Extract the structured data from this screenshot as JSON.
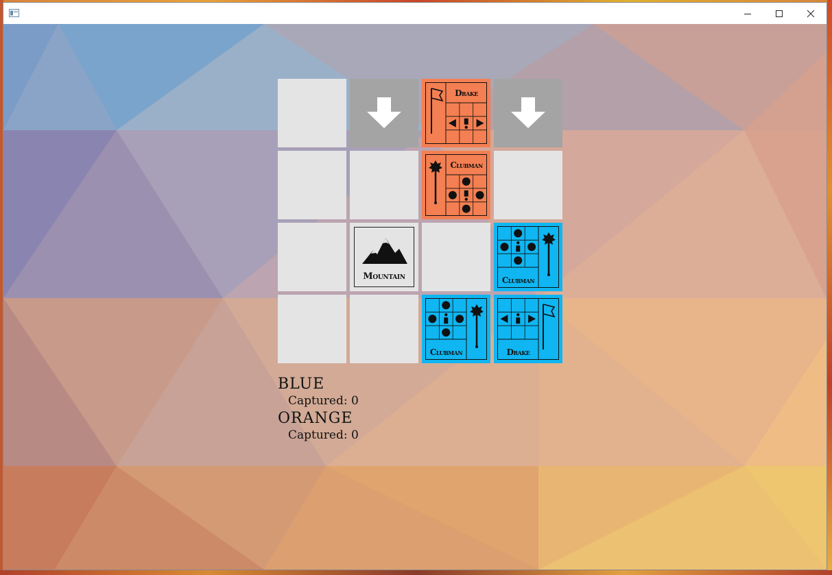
{
  "window": {
    "title": "",
    "controls": [
      "minimize-icon",
      "maximize-icon",
      "close-icon"
    ]
  },
  "colors": {
    "orange_team": "#f47f52",
    "blue_team": "#0fb6f2",
    "empty_tile": "#e4e4e4",
    "move_tile": "#a4a4a4"
  },
  "board": {
    "rows": 4,
    "cols": 4,
    "cells": [
      [
        {
          "type": "empty"
        },
        {
          "type": "move-target",
          "icon": "arrow-down-icon"
        },
        {
          "type": "unit",
          "team": "orange",
          "name": "Drake",
          "icon": "flag-icon"
        },
        {
          "type": "move-target",
          "icon": "arrow-down-icon"
        }
      ],
      [
        {
          "type": "empty"
        },
        {
          "type": "empty"
        },
        {
          "type": "unit",
          "team": "orange",
          "name": "Clubman",
          "icon": "mace-icon"
        },
        {
          "type": "empty"
        }
      ],
      [
        {
          "type": "empty"
        },
        {
          "type": "terrain",
          "name": "Mountain",
          "icon": "mountain-icon"
        },
        {
          "type": "empty"
        },
        {
          "type": "unit",
          "team": "blue",
          "name": "Clubman",
          "icon": "mace-icon"
        }
      ],
      [
        {
          "type": "empty"
        },
        {
          "type": "empty"
        },
        {
          "type": "unit",
          "team": "blue",
          "name": "Clubman",
          "icon": "mace-icon"
        },
        {
          "type": "unit",
          "team": "blue",
          "name": "Drake",
          "icon": "flag-icon"
        }
      ]
    ]
  },
  "teams": [
    {
      "name": "BLUE",
      "captured_label": "Captured:",
      "captured": 0
    },
    {
      "name": "ORANGE",
      "captured_label": "Captured:",
      "captured": 0
    }
  ]
}
